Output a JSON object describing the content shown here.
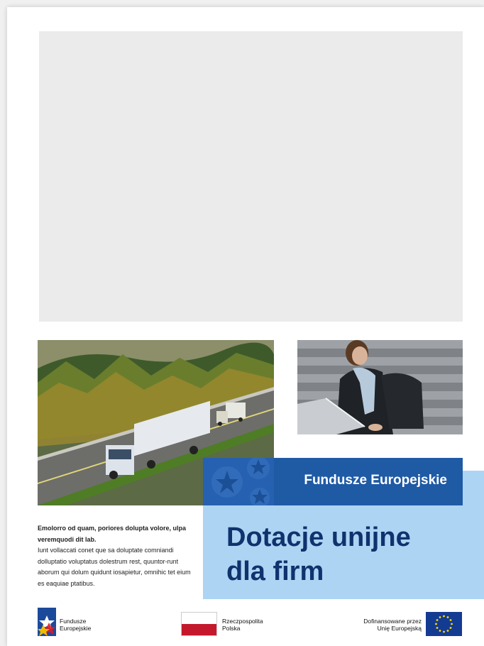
{
  "fe_band": {
    "title": "Fundusze Europejskie"
  },
  "main": {
    "title_line1": "Dotacje unijne",
    "title_line2": "dla firm"
  },
  "body": {
    "lead": "Emolorro od quam, poriores dolupta volore, ulpa veremquodi dit lab.",
    "text": "Iunt vollaccati conet que sa doluptate comniandi dolluptatio voluptatus dolestrum rest, quuntor-runt aborum qui dolum quidunt iosapietur, omnihic tet eium es eaquiae ptatibus."
  },
  "logos": {
    "fe": {
      "line1": "Fundusze",
      "line2": "Europejskie"
    },
    "pl": {
      "line1": "Rzeczpospolita",
      "line2": "Polska"
    },
    "eu": {
      "line1": "Dofinansowane przez",
      "line2": "Unię Europejską"
    }
  },
  "colors": {
    "fe_blue": "#1f5aa5",
    "title_navy": "#10336e",
    "light_blue": "#aed4f3",
    "polish_red": "#c4182c",
    "eu_blue": "#143b92",
    "eu_star": "#ffdd00"
  }
}
